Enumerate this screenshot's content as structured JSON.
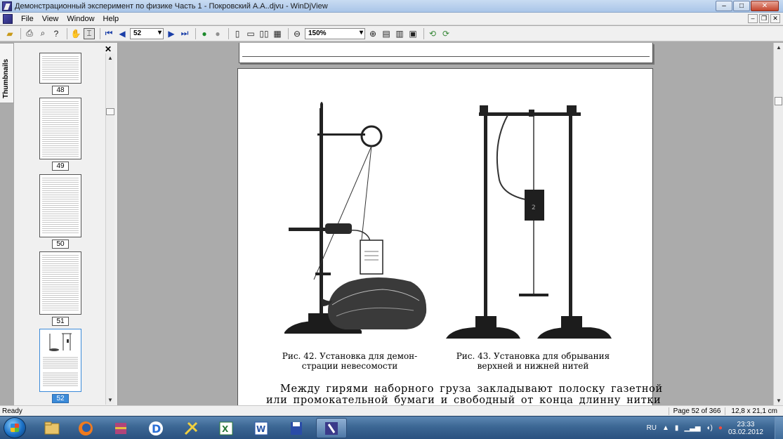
{
  "window": {
    "title": "Демонстрационный эксперимент по физике Часть 1 - Покровский А.А..djvu - WinDjView",
    "minimize": "–",
    "maximize": "□",
    "close": "✕"
  },
  "menu": {
    "items": [
      "File",
      "View",
      "Window",
      "Help"
    ],
    "mdi_minimize": "–",
    "mdi_restore": "❐",
    "mdi_close": "✕"
  },
  "toolbar": {
    "page_value": "52",
    "zoom_value": "150%"
  },
  "sidebar": {
    "tab_label": "Thumbnails",
    "close": "✕",
    "thumbnails": [
      {
        "page": "48",
        "selected": false
      },
      {
        "page": "49",
        "selected": false
      },
      {
        "page": "50",
        "selected": false
      },
      {
        "page": "51",
        "selected": false
      },
      {
        "page": "52",
        "selected": true
      }
    ]
  },
  "document": {
    "caption_left": "Рис. 42. Установка для демон-\nстрации невесомости",
    "caption_left_1": "Рис. 42. Установка для демон-",
    "caption_left_2": "страции невесомости",
    "caption_right_1": "Рис. 43. Установка для обрывания",
    "caption_right_2": "верхней и нижней нитей",
    "body_line_1": "Между гирями наборного груза закладывают полоску газетной",
    "body_line_2": "или промокательной бумаги и свободный от конца длинну нитки"
  },
  "status": {
    "ready": "Ready",
    "page": "Page 52 of 366",
    "size": "12,8 x 21,1 cm"
  },
  "taskbar": {
    "lang": "RU",
    "time": "23:33",
    "date": "03.02.2012"
  }
}
